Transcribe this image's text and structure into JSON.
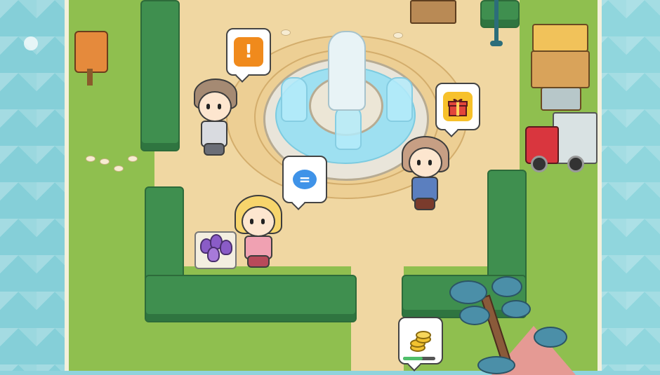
{
  "scene": {
    "type": "top-down cozy village plaza"
  },
  "quest_markers": {
    "alert": {
      "icon": "exclamation-icon",
      "glyph": "!",
      "color": "#f08a1c"
    },
    "gift": {
      "icon": "gift-icon",
      "color": "#f7c12b"
    },
    "chat": {
      "icon": "chat-icon",
      "glyph": "=",
      "color": "#3f93e8"
    },
    "coins": {
      "icon": "coin-stack-icon",
      "progress": 0.6,
      "color": "#f2c230"
    }
  },
  "characters": [
    {
      "id": "brown-hair-boy",
      "hair_color": "#a58a73"
    },
    {
      "id": "overalls-girl",
      "hair_color": "#c79f84"
    },
    {
      "id": "blonde-girl",
      "hair_color": "#f7d56c"
    }
  ],
  "colors": {
    "grass": "#8fbf4f",
    "hedge": "#3f8f4f",
    "path": "#f0d7a2",
    "water": "#9ee0f1",
    "sea": "#8fd3dd"
  }
}
